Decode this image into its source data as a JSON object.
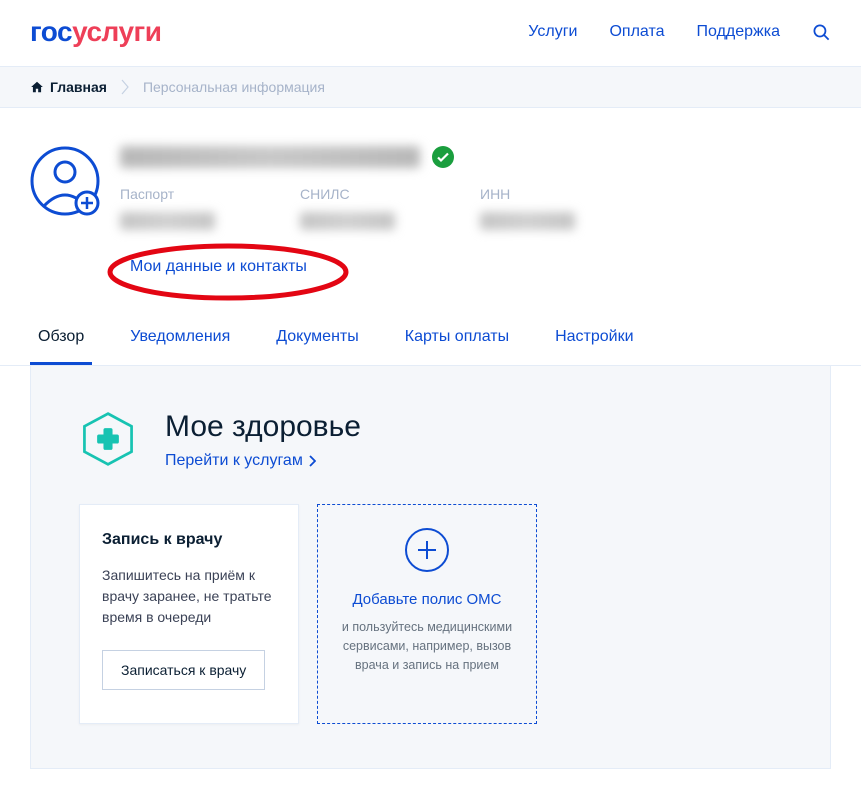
{
  "header": {
    "logo_blue": "гос",
    "logo_red": "услуги",
    "nav": {
      "services": "Услуги",
      "payment": "Оплата",
      "support": "Поддержка"
    }
  },
  "breadcrumb": {
    "home": "Главная",
    "current": "Персональная информация"
  },
  "profile": {
    "docs": {
      "passport": "Паспорт",
      "snils": "СНИЛС",
      "inn": "ИНН"
    },
    "my_data_link": "Мои данные и контакты"
  },
  "tabs": {
    "overview": "Обзор",
    "notifications": "Уведомления",
    "documents": "Документы",
    "payment_cards": "Карты оплаты",
    "settings": "Настройки"
  },
  "health": {
    "title": "Мое здоровье",
    "go_link": "Перейти к услугам",
    "card1": {
      "title": "Запись к врачу",
      "text": "Запишитесь на приём к врачу заранее, не тратьте время в очереди",
      "button": "Записаться к врачу"
    },
    "card2": {
      "link": "Добавьте полис ОМС",
      "text": "и пользуйтесь медицинскими сервисами, например, вызов врача и запись на прием"
    }
  }
}
